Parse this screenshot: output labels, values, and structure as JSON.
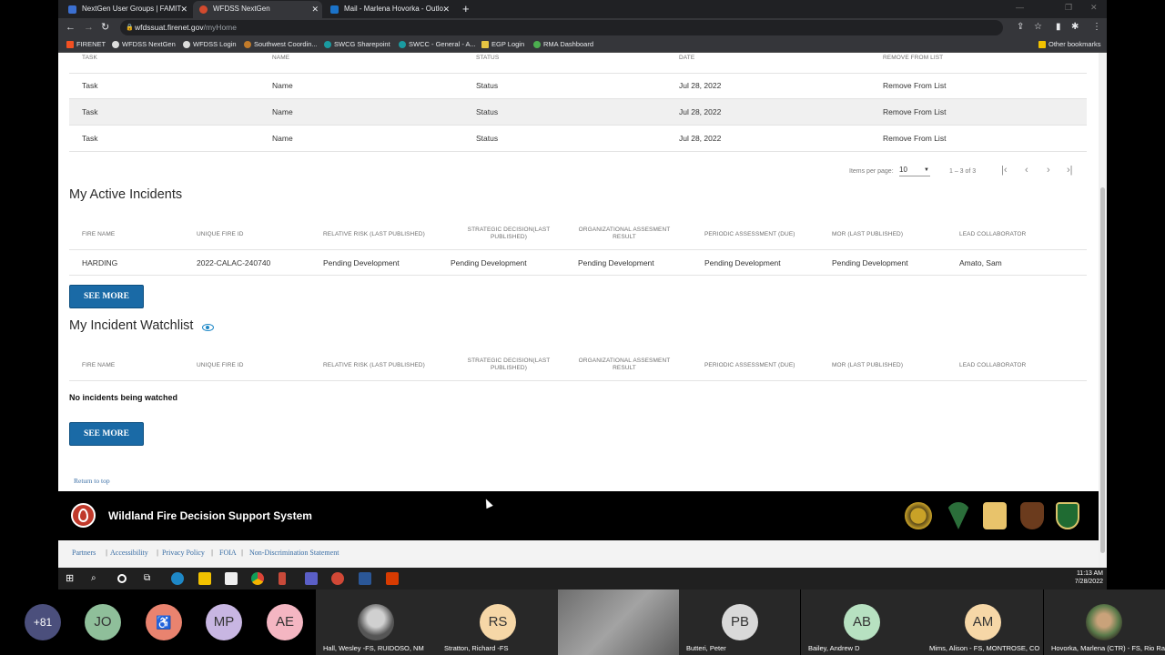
{
  "browser": {
    "tabs": [
      {
        "title": "NextGen User Groups | FAMIT",
        "active": false
      },
      {
        "title": "WFDSS NextGen",
        "active": true
      },
      {
        "title": "Mail - Marlena Hovorka - Outlo",
        "active": false
      }
    ],
    "url_host": "wfdssuat.firenet.gov",
    "url_path": "/myHome",
    "bookmarks": [
      "FIRENET",
      "WFDSS NextGen",
      "WFDSS Login",
      "Southwest Coordin...",
      "SWCG Sharepoint",
      "SWCC - General - A...",
      "EGP Login",
      "RMA Dashboard"
    ],
    "other_bookmarks": "Other bookmarks"
  },
  "tasks_table": {
    "headers": {
      "task": "TASK",
      "name": "NAME",
      "status": "STATUS",
      "date": "DATE",
      "remove": "REMOVE FROM LIST"
    },
    "rows": [
      {
        "task": "Task",
        "name": "Name",
        "status": "Status",
        "date": "Jul 28, 2022",
        "remove": "Remove From List"
      },
      {
        "task": "Task",
        "name": "Name",
        "status": "Status",
        "date": "Jul 28, 2022",
        "remove": "Remove From List"
      },
      {
        "task": "Task",
        "name": "Name",
        "status": "Status",
        "date": "Jul 28, 2022",
        "remove": "Remove From List"
      }
    ],
    "paginator": {
      "items_per_page_label": "Items per page:",
      "items_per_page": "10",
      "range": "1 – 3 of 3"
    }
  },
  "active_incidents": {
    "title": "My Active Incidents",
    "headers": {
      "fire_name": "FIRE NAME",
      "unique_fire_id": "UNIQUE FIRE ID",
      "relative_risk": "RELATIVE RISK (LAST PUBLISHED)",
      "strategic_decision": "STRATEGIC DECISION(LAST PUBLISHED)",
      "org_assessment": "ORGANIZATIONAL ASSESMENT RESULT",
      "periodic_assessment": "PERIODIC ASSESSMENT (DUE)",
      "mor": "MOR (LAST PUBLISHED)",
      "lead_collaborator": "LEAD COLLABORATOR"
    },
    "rows": [
      {
        "fire_name": "HARDING",
        "unique_fire_id": "2022-CALAC-240740",
        "relative_risk": "Pending Development",
        "strategic_decision": "Pending Development",
        "org_assessment": "Pending Development",
        "periodic_assessment": "Pending Development",
        "mor": "Pending Development",
        "lead_collaborator": "Amato, Sam"
      }
    ],
    "see_more": "SEE MORE"
  },
  "watchlist": {
    "title": "My Incident Watchlist",
    "empty_message": "No incidents being watched",
    "see_more": "SEE MORE"
  },
  "return_to_top": "Return to top",
  "footer": {
    "title": "Wildland Fire Decision Support System",
    "links": [
      "Partners",
      "Accessibility",
      "Privacy Policy",
      "FOIA",
      "Non-Discrimination Statement"
    ]
  },
  "taskbar": {
    "time": "11:13 AM",
    "date": "7/28/2022"
  },
  "meeting": {
    "overflow_count": "+81",
    "avatars": [
      {
        "initials": "JO",
        "color": "#8fbf9a"
      },
      {
        "initials": "",
        "color": "#e9836f"
      },
      {
        "initials": "MP",
        "color": "#c8b6e2"
      },
      {
        "initials": "AE",
        "color": "#f4b6c2"
      }
    ],
    "tiles": [
      {
        "name": "Hall, Wesley -FS, RUIDOSO, NM",
        "initials": "",
        "color": "#777777"
      },
      {
        "name": "Stratton, Richard -FS",
        "initials": "RS",
        "color": "#f6d7a7"
      },
      {
        "name": "",
        "initials": "",
        "color": "#888888"
      },
      {
        "name": "Butteri, Peter",
        "initials": "PB",
        "color": "#d9d9d9"
      },
      {
        "name": "Bailey, Andrew D",
        "initials": "AB",
        "color": "#b7e1c1"
      },
      {
        "name": "Mims, Alison - FS, MONTROSE, CO",
        "initials": "AM",
        "color": "#f6d7a7"
      },
      {
        "name": "Hovorka, Marlena (CTR) - FS, Rio Ra...",
        "initials": "",
        "color": "#8a6a4a"
      }
    ]
  }
}
